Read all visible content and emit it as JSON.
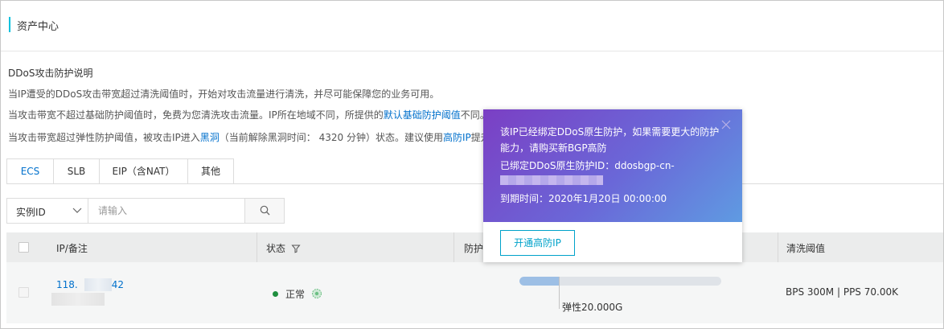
{
  "header": {
    "title": "资产中心"
  },
  "description": {
    "heading": "DDoS攻击防护说明",
    "line1": "当IP遭受的DDoS攻击带宽超过清洗阈值时，开始对攻击流量进行清洗，并尽可能保障您的业务可用。",
    "line2_pre": "当攻击带宽不超过基础防护阈值时，免费为您清洗攻击流量。IP所在地域不同，所提供的",
    "line2_link": "默认基础防护阈值",
    "line2_post": "不同。",
    "line3_pre": "当攻击带宽超过弹性防护阈值，被攻击IP进入",
    "line3_link": "黑洞",
    "line3_mid": "（当前解除黑洞时间：  4320 分钟）状态。建议使用",
    "line3_link2": "高防IP",
    "line3_post": "提升"
  },
  "tabs": [
    {
      "label": "ECS",
      "active": true
    },
    {
      "label": "SLB",
      "active": false
    },
    {
      "label": "EIP（含NAT）",
      "active": false
    },
    {
      "label": "其他",
      "active": false
    }
  ],
  "search": {
    "select_value": "实例ID",
    "placeholder": "请输入"
  },
  "table": {
    "columns": [
      "IP/备注",
      "状态",
      "防护",
      "清洗阈值"
    ],
    "rows": [
      {
        "ip_prefix": "118.",
        "ip_suffix": "42",
        "status": "正常",
        "protection_progress": 0.2,
        "elastic": "弹性20.000G",
        "threshold": "BPS 300M | PPS 70.00K"
      }
    ]
  },
  "popover": {
    "text1": "该IP已经绑定DDoS原生防护，如果需要更大的防护能力，请购买新BGP高防",
    "text2": "已绑定DDoS原生防护ID：ddosbgp-cn-",
    "text3": "到期时间：2020年1月20日 00:00:00",
    "button": "开通高防IP"
  },
  "colors": {
    "accent": "#00c1de",
    "link": "#0070cc",
    "status_ok": "#1e8e3e",
    "button_border": "#00a2ca"
  }
}
